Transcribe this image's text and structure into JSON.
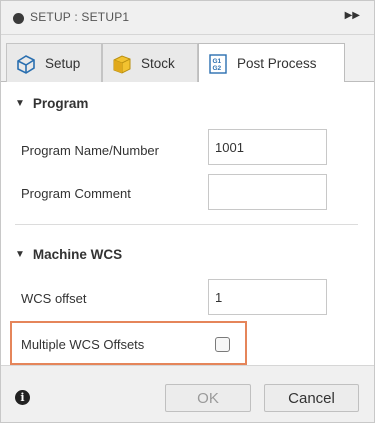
{
  "title": {
    "text": "SETUP : SETUP1"
  },
  "tabs": [
    {
      "label": "Setup",
      "icon": "setup-icon"
    },
    {
      "label": "Stock",
      "icon": "stock-icon"
    },
    {
      "label": "Post Process",
      "icon": "post-process-icon",
      "active": true
    }
  ],
  "groups": {
    "program": {
      "label": "Program",
      "fields": {
        "name_number": {
          "label": "Program Name/Number",
          "value": "1001"
        },
        "comment": {
          "label": "Program Comment",
          "value": ""
        }
      }
    },
    "machine_wcs": {
      "label": "Machine WCS",
      "fields": {
        "wcs_offset": {
          "label": "WCS offset",
          "value": "1"
        },
        "multiple_wcs": {
          "label": "Multiple WCS Offsets",
          "checked": false
        }
      }
    }
  },
  "footer": {
    "ok_label": "OK",
    "cancel_label": "Cancel"
  },
  "colors": {
    "highlight": "#e5855a",
    "stock_cube": "#f2c230"
  }
}
